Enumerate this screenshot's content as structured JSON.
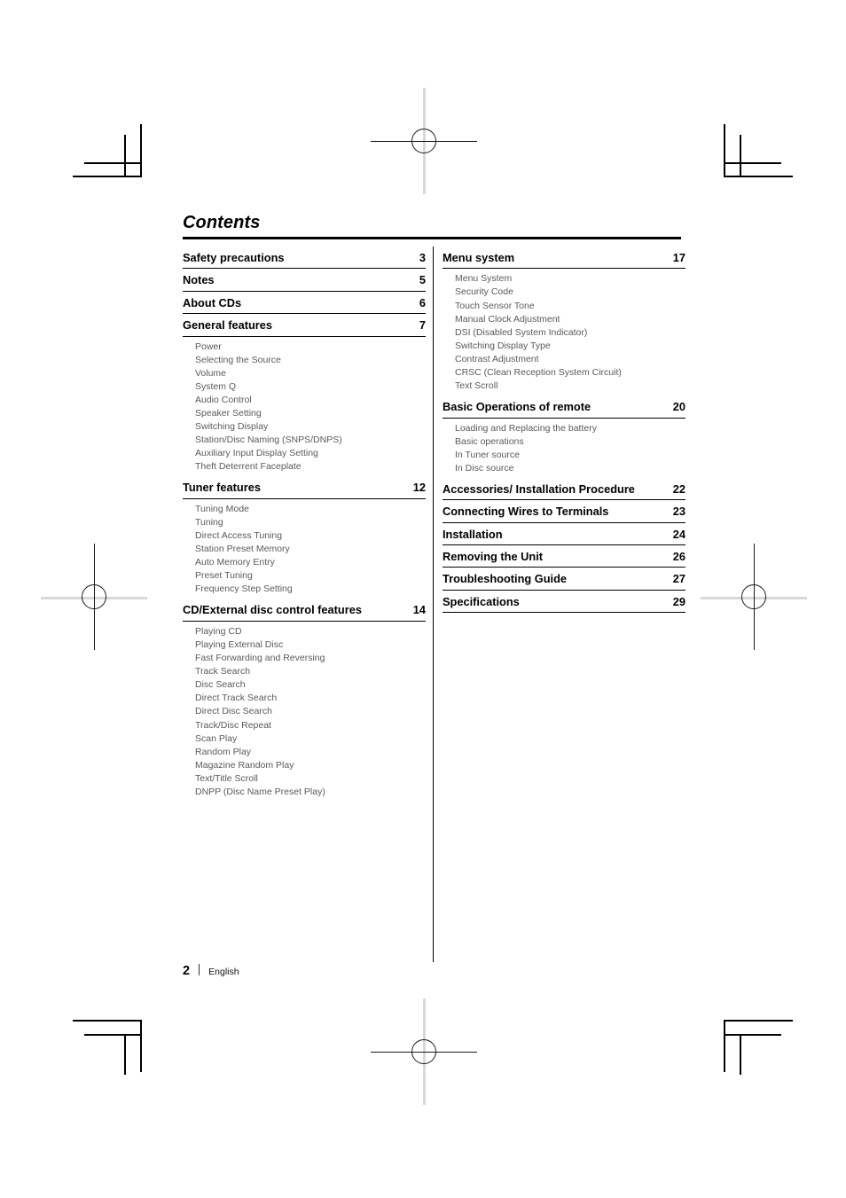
{
  "document": {
    "title": "Contents",
    "footer": {
      "page_number": "2",
      "language": "English"
    }
  },
  "columns": {
    "left": [
      {
        "label": "Safety precautions",
        "page": "3",
        "items": []
      },
      {
        "label": "Notes",
        "page": "5",
        "items": []
      },
      {
        "label": "About CDs",
        "page": "6",
        "items": []
      },
      {
        "label": "General features",
        "page": "7",
        "items": [
          "Power",
          "Selecting the Source",
          "Volume",
          "System Q",
          "Audio Control",
          "Speaker Setting",
          "Switching Display",
          "Station/Disc Naming (SNPS/DNPS)",
          "Auxiliary Input Display Setting",
          "Theft Deterrent Faceplate"
        ]
      },
      {
        "label": "Tuner features",
        "page": "12",
        "items": [
          "Tuning Mode",
          "Tuning",
          "Direct Access Tuning",
          "Station Preset Memory",
          "Auto Memory Entry",
          "Preset Tuning",
          "Frequency Step Setting"
        ]
      },
      {
        "label": "CD/External disc control features",
        "page": "14",
        "items": [
          "Playing CD",
          "Playing External Disc",
          "Fast Forwarding and Reversing",
          "Track Search",
          "Disc Search",
          "Direct Track Search",
          "Direct Disc Search",
          "Track/Disc Repeat",
          "Scan Play",
          "Random Play",
          "Magazine Random Play",
          "Text/Title Scroll",
          "DNPP (Disc Name Preset Play)"
        ]
      }
    ],
    "right": [
      {
        "label": "Menu system",
        "page": "17",
        "items": [
          "Menu System",
          "Security Code",
          "Touch Sensor Tone",
          "Manual Clock Adjustment",
          "DSI (Disabled System Indicator)",
          "Switching Display Type",
          "Contrast Adjustment",
          "CRSC (Clean Reception System Circuit)",
          "Text Scroll"
        ]
      },
      {
        "label": "Basic Operations of remote",
        "page": "20",
        "items": [
          "Loading and Replacing the battery",
          "Basic operations",
          "In Tuner source",
          "In Disc source"
        ]
      },
      {
        "label": "Accessories/ Installation Procedure",
        "page": "22",
        "items": []
      },
      {
        "label": "Connecting Wires to Terminals",
        "page": "23",
        "items": []
      },
      {
        "label": "Installation",
        "page": "24",
        "items": []
      },
      {
        "label": "Removing the Unit",
        "page": "26",
        "items": []
      },
      {
        "label": "Troubleshooting Guide",
        "page": "27",
        "items": []
      },
      {
        "label": "Specifications",
        "page": "29",
        "items": []
      }
    ]
  },
  "print_marks": {
    "crop_mark_color": "#000000",
    "registration_mark_color": "#1a1a1a"
  }
}
